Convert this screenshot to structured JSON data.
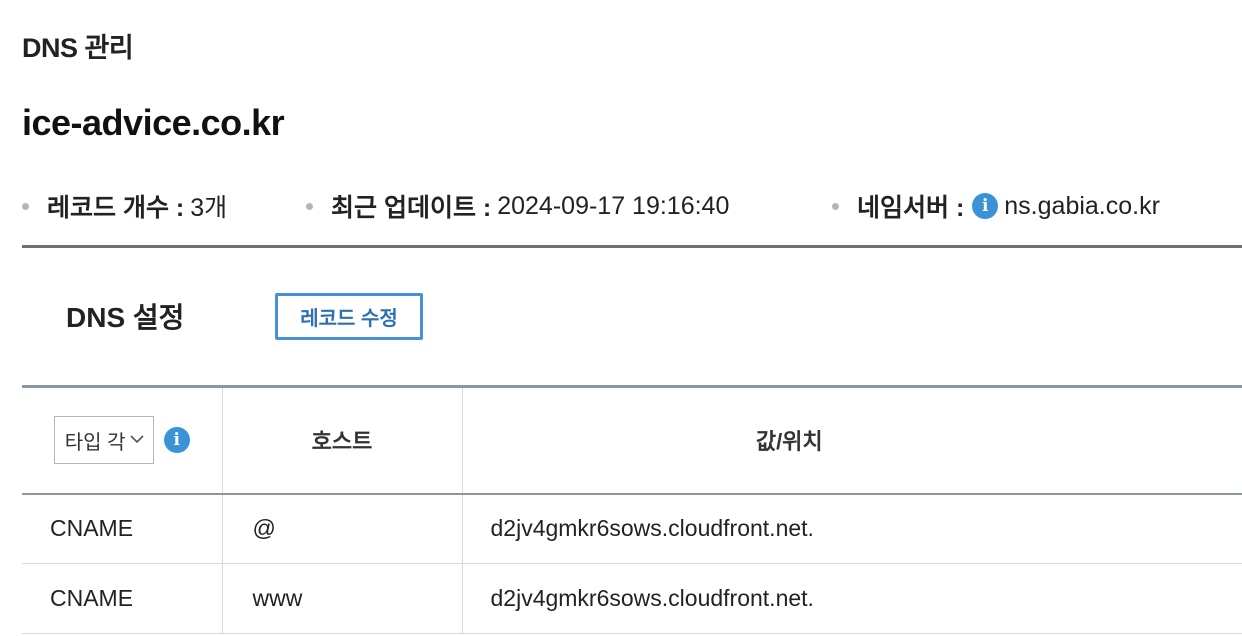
{
  "header": {
    "section_title": "DNS 관리",
    "domain": "ice-advice.co.kr"
  },
  "summary": {
    "record_count_label": "레코드 개수 :",
    "record_count_value": "3개",
    "last_update_label": "최근 업데이트 :",
    "last_update_value": "2024-09-17 19:16:40",
    "nameserver_label": "네임서버 :",
    "nameserver_value": "ns.gabia.co.kr",
    "info_icon": "info-icon"
  },
  "dns_settings": {
    "title": "DNS 설정",
    "edit_button_label": "레코드 수정"
  },
  "table": {
    "type_filter_value": "타입 각",
    "columns": [
      "호스트",
      "값/위치"
    ],
    "rows": [
      {
        "type": "CNAME",
        "host": "@",
        "value": "d2jv4gmkr6sows.cloudfront.net."
      },
      {
        "type": "CNAME",
        "host": "www",
        "value": "d2jv4gmkr6sows.cloudfront.net."
      }
    ]
  },
  "colors": {
    "accent": "#3a93d6",
    "button_border": "#4a90d6",
    "divider": "#707070"
  }
}
